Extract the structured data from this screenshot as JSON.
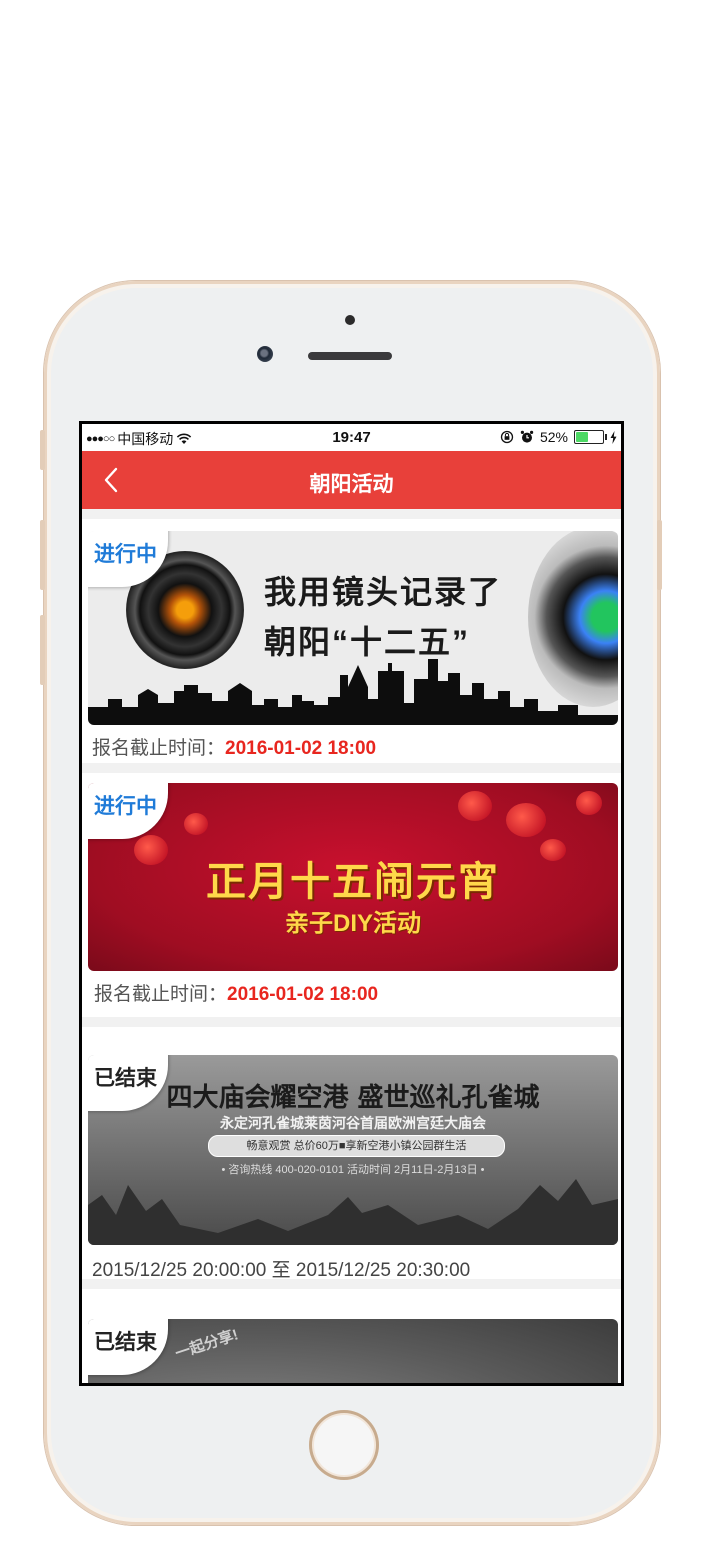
{
  "status_bar": {
    "signal": "●●●○○",
    "carrier": "中国移动",
    "time": "19:47",
    "battery_percent": "52%",
    "battery_level": 0.52
  },
  "nav": {
    "title": "朝阳活动"
  },
  "activities": [
    {
      "status": "进行中",
      "banner_line1": "我用镜头记录了",
      "banner_line2": "朝阳“十二五”",
      "caption_label": "报名截止时间：",
      "caption_date": "2016-01-02 18:00"
    },
    {
      "status": "进行中",
      "banner_line1": "正月十五闹元宵",
      "banner_line2": "亲子DIY活动",
      "caption_label": "报名截止时间：",
      "caption_date": "2016-01-02 18:00"
    },
    {
      "status": "已结束",
      "banner_line1": "四大庙会耀空港 盛世巡礼孔雀城",
      "banner_line2": "永定河孔雀城莱茵河谷首届欧洲宫廷大庙会",
      "banner_line3": "畅意观赏 总价60万■享新空港小镇公园群生活",
      "banner_line4": "• 咨询热线 400-020-0101  活动时间 2月11日-2月13日 •",
      "caption_text": "2015/12/25 20:00:00  至  2015/12/25 20:30:00"
    },
    {
      "status": "已结束",
      "banner_line1": "一起分享!"
    }
  ],
  "colors": {
    "nav_red": "#e8403a",
    "date_red": "#e8261f",
    "active_tag_blue": "#1f7bd8"
  }
}
